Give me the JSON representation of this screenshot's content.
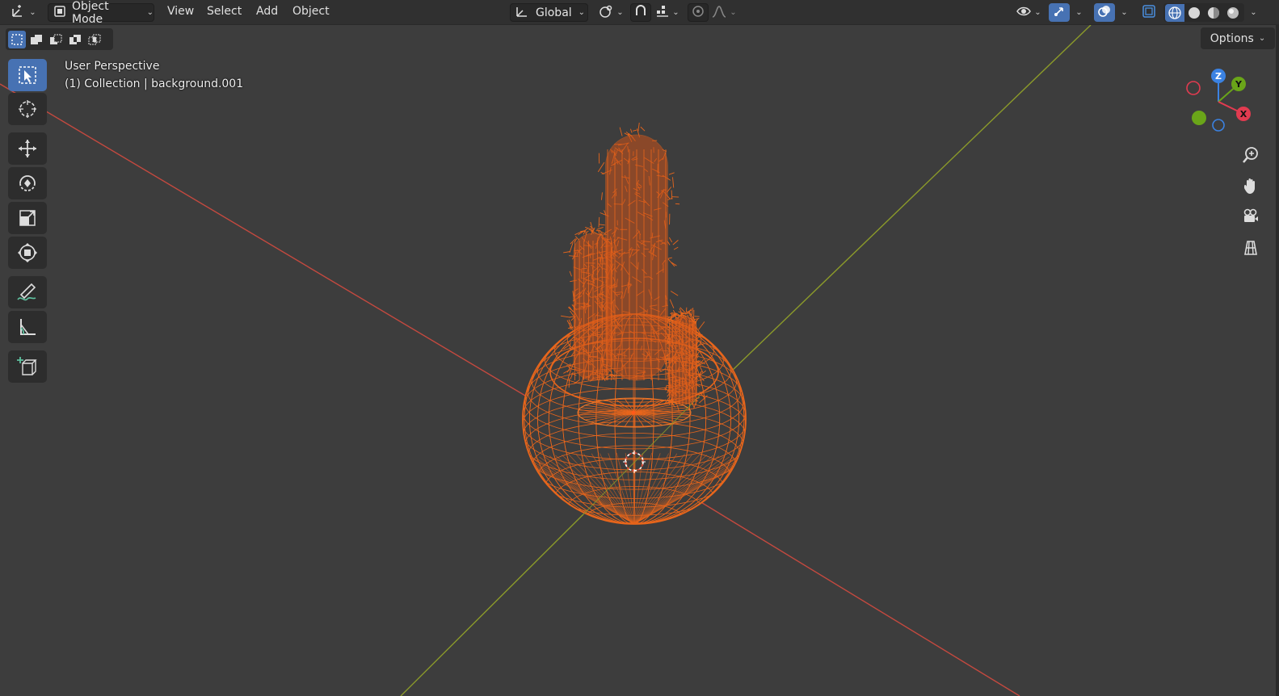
{
  "header": {
    "editor_type_icon": "axis-editor-icon",
    "mode_label": "Object Mode",
    "menus": [
      "View",
      "Select",
      "Add",
      "Object"
    ],
    "transform_orientation": "Global",
    "icons": [
      "pivot-icon",
      "snap-icon",
      "snap-increment-icon",
      "proportional-edit-icon",
      "falloff-icon",
      "visibility-icon",
      "gizmo-icon",
      "overlay-icon",
      "xray-icon",
      "wireframe-shading-icon",
      "solid-shading-icon",
      "material-shading-icon",
      "rendered-shading-icon"
    ]
  },
  "viewport": {
    "perspective_label": "User Perspective",
    "collection_label": "(1) Collection | background.001",
    "options_label": "Options",
    "select_modes": [
      "select-new-icon",
      "select-extend-icon",
      "select-subtract-icon",
      "select-difference-icon",
      "select-intersect-icon"
    ],
    "tools": [
      "select-box-icon",
      "cursor-icon",
      "move-icon",
      "rotate-icon",
      "scale-icon",
      "transform-icon",
      "annotate-icon",
      "measure-icon",
      "add-cube-icon"
    ],
    "gizmo": {
      "x_label": "X",
      "y_label": "Y",
      "z_label": "Z"
    },
    "nav_icons": [
      "zoom-icon",
      "pan-hand-icon",
      "camera-icon",
      "orthographic-grid-icon"
    ]
  },
  "colors": {
    "background": "#3d3d3d",
    "header": "#303030",
    "accent": "#4772b3",
    "selection": "#e8661c",
    "x_axis": "#c4493f",
    "y_axis": "#8b9a2a",
    "gizmo_x": "#e23b50",
    "gizmo_y": "#6aa519",
    "gizmo_z": "#3b82e2"
  }
}
